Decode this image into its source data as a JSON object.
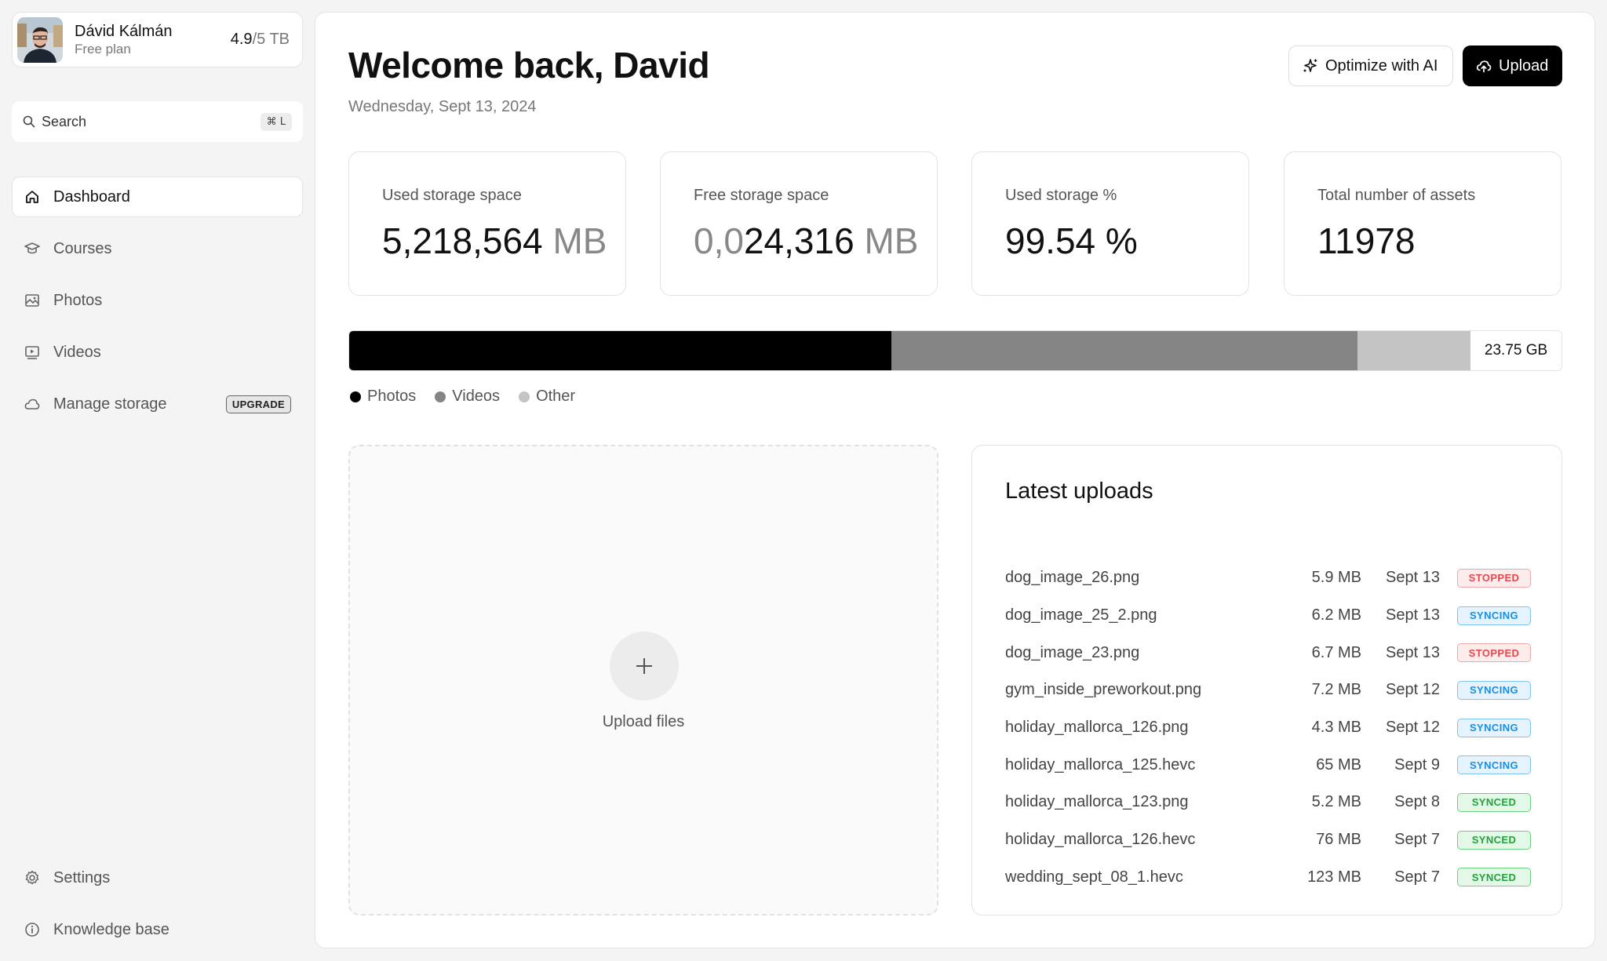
{
  "profile": {
    "name": "Dávid Kálmán",
    "plan": "Free plan",
    "quota_used": "4.9",
    "quota_total": "/5 TB"
  },
  "search": {
    "label": "Search",
    "shortcut": "⌘ L"
  },
  "nav": {
    "dashboard": "Dashboard",
    "courses": "Courses",
    "photos": "Photos",
    "videos": "Videos",
    "manage_storage": "Manage storage",
    "upgrade_badge": "UPGRADE",
    "settings": "Settings",
    "knowledge_base": "Knowledge base"
  },
  "header": {
    "title": "Welcome back, David",
    "date": "Wednesday, Sept 13, 2024",
    "optimize_label": "Optimize with AI",
    "upload_label": "Upload"
  },
  "stats": {
    "used_label": "Used storage space",
    "used_value": "5,218,564",
    "used_unit": "MB",
    "free_label": "Free storage space",
    "free_value_prefix": "0,0",
    "free_value": "24,316",
    "free_unit": "MB",
    "percent_label": "Used storage %",
    "percent_value": "99.54 %",
    "assets_label": "Total number of assets",
    "assets_value": "11978"
  },
  "storage_bar": {
    "total_label": "23.75 GB",
    "segments": [
      {
        "name": "Photos",
        "fraction": 0.447,
        "color": "#000000"
      },
      {
        "name": "Videos",
        "fraction": 0.385,
        "color": "#858585"
      },
      {
        "name": "Other",
        "fraction": 0.093,
        "color": "#c4c4c4"
      }
    ]
  },
  "legend": {
    "photos": "Photos",
    "videos": "Videos",
    "other": "Other"
  },
  "dropzone": {
    "label": "Upload files"
  },
  "latest_uploads": {
    "title": "Latest uploads",
    "rows": [
      {
        "name": "dog_image_26.png",
        "size": "5.9 MB",
        "date": "Sept 13",
        "status": "STOPPED"
      },
      {
        "name": "dog_image_25_2.png",
        "size": "6.2 MB",
        "date": "Sept 13",
        "status": "SYNCING"
      },
      {
        "name": "dog_image_23.png",
        "size": "6.7 MB",
        "date": "Sept 13",
        "status": "STOPPED"
      },
      {
        "name": "gym_inside_preworkout.png",
        "size": "7.2 MB",
        "date": "Sept 12",
        "status": "SYNCING"
      },
      {
        "name": "holiday_mallorca_126.png",
        "size": "4.3 MB",
        "date": "Sept 12",
        "status": "SYNCING"
      },
      {
        "name": "holiday_mallorca_125.hevc",
        "size": "65 MB",
        "date": "Sept 9",
        "status": "SYNCING"
      },
      {
        "name": "holiday_mallorca_123.png",
        "size": "5.2 MB",
        "date": "Sept 8",
        "status": "SYNCED"
      },
      {
        "name": "holiday_mallorca_126.hevc",
        "size": "76 MB",
        "date": "Sept 7",
        "status": "SYNCED"
      },
      {
        "name": "wedding_sept_08_1.hevc",
        "size": "123 MB",
        "date": "Sept 7",
        "status": "SYNCED"
      }
    ]
  }
}
